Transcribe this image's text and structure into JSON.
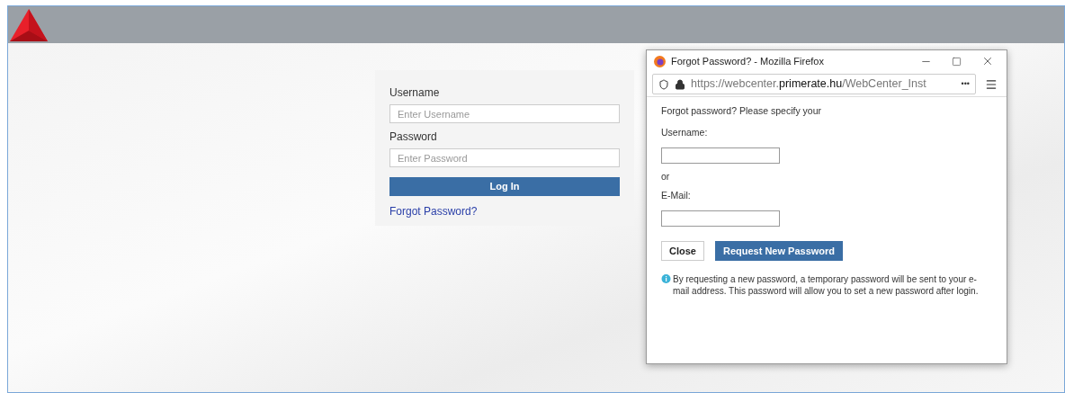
{
  "login": {
    "username_label": "Username",
    "username_placeholder": "Enter Username",
    "password_label": "Password",
    "password_placeholder": "Enter Password",
    "login_button": "Log In",
    "forgot_link": "Forgot Password?"
  },
  "popup": {
    "title": "Forgot Password? - Mozilla Firefox",
    "url": {
      "prefix": "https://webcenter.",
      "domain": "primerate.hu",
      "path": "/WebCenter_Inst"
    },
    "more": "•••",
    "intro": "Forgot password? Please specify your",
    "username_label": "Username:",
    "or": "or",
    "email_label": "E-Mail:",
    "close_button": "Close",
    "request_button": "Request New Password",
    "info": "By requesting a new password, a temporary password will be sent to your e-mail address. This password will allow you to set a new password after login."
  }
}
